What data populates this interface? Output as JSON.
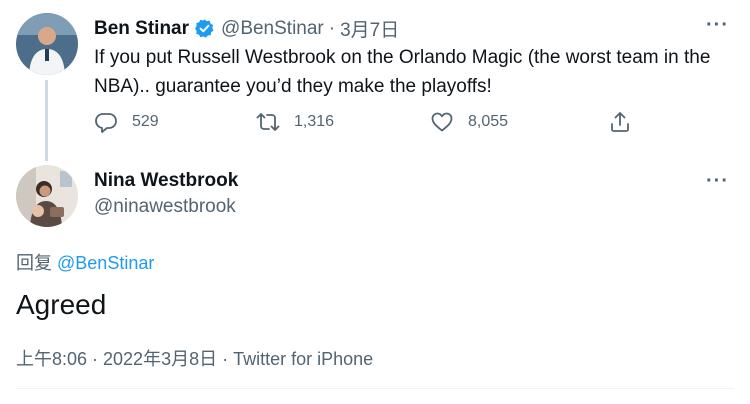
{
  "tweet": {
    "author_name": "Ben Stinar",
    "verified": true,
    "handle": "@BenStinar",
    "separator": "·",
    "date": "3月7日",
    "text": "If you put Russell Westbrook on the Orlando Magic (the worst team in the NBA).. guarantee you’d they make the playoffs!",
    "more": "···",
    "actions": {
      "reply_count": "529",
      "retweet_count": "1,316",
      "like_count": "8,055"
    }
  },
  "reply": {
    "author_name": "Nina Westbrook",
    "handle": "@ninawestbrook",
    "more": "···",
    "reply_prefix": "回复",
    "reply_mention": "@BenStinar",
    "text": "Agreed",
    "timestamp": "上午8:06 · 2022年3月8日 · Twitter for iPhone"
  },
  "colors": {
    "accent": "#1d9bf0",
    "muted": "#536471",
    "text": "#0f1419"
  }
}
